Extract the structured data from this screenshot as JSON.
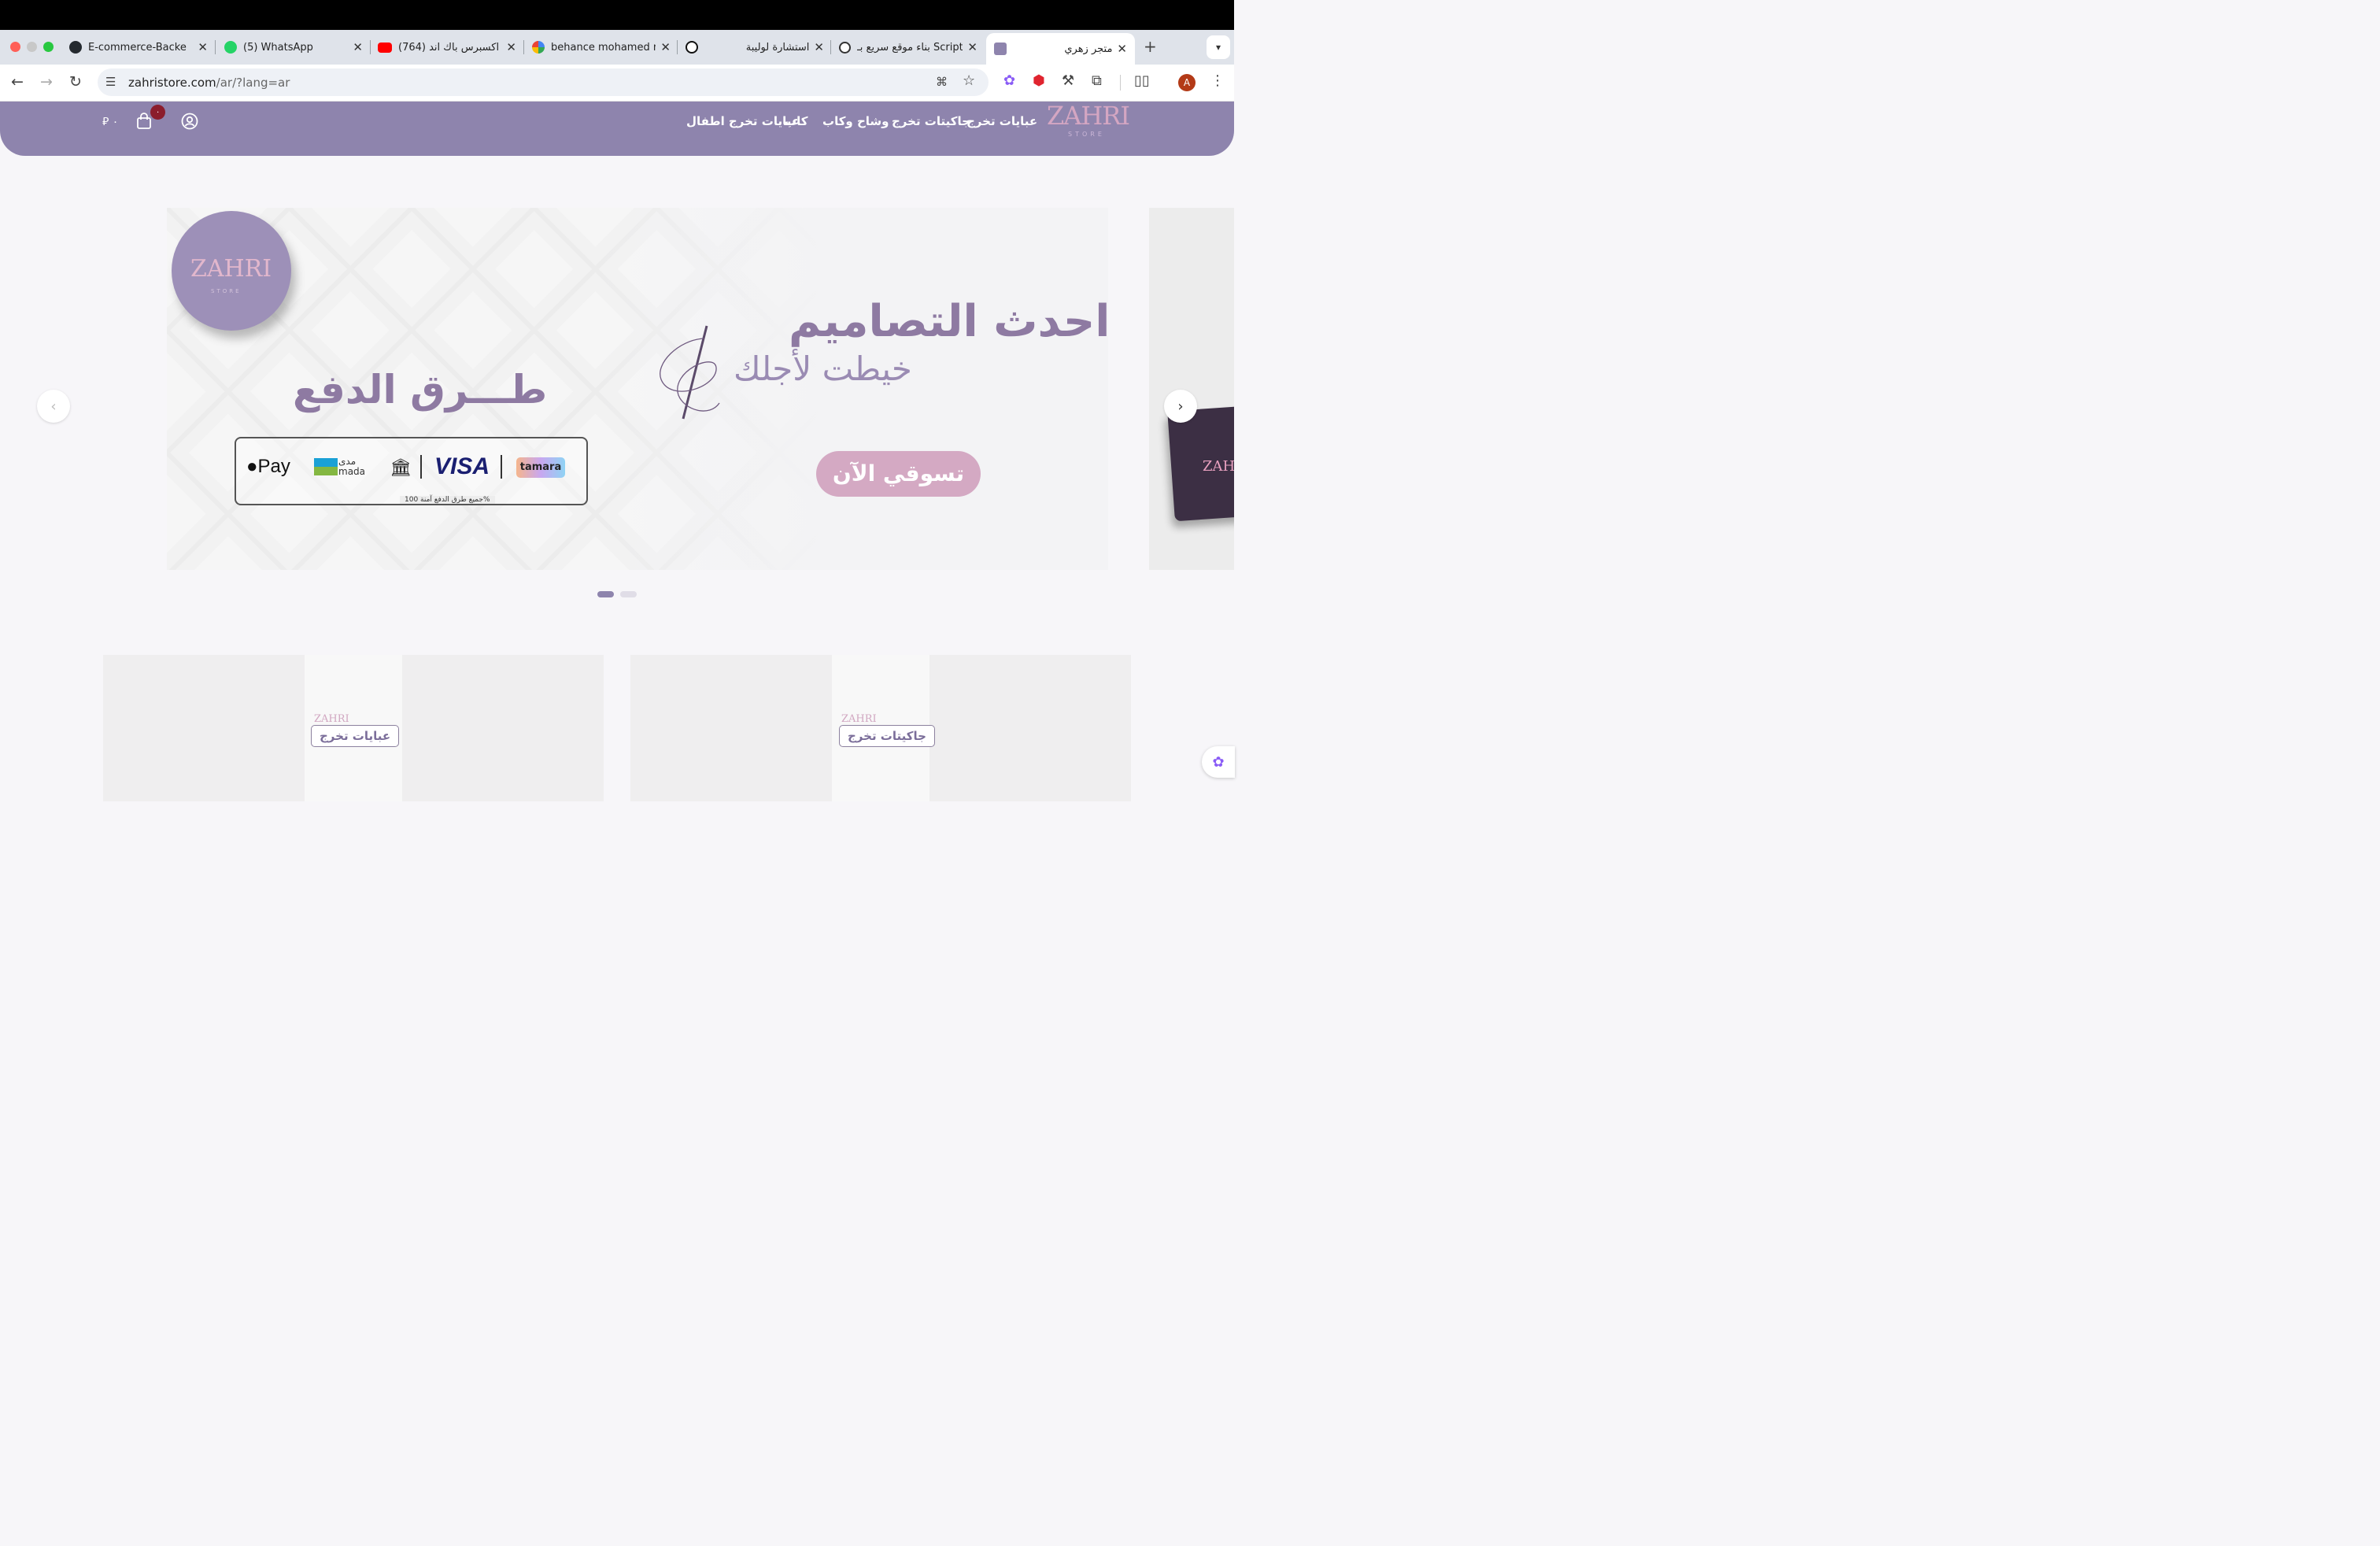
{
  "browser": {
    "tabs": [
      {
        "title": "E-commerce-Backe",
        "icon": "github-icon"
      },
      {
        "title": "(5) WhatsApp",
        "icon": "whatsapp-icon"
      },
      {
        "title": "(764) اكسبرس باك اند",
        "icon": "youtube-icon"
      },
      {
        "title": "behance mohamed n",
        "icon": "google-icon"
      },
      {
        "title": "استشارة لوليبة",
        "icon": "openai-icon"
      },
      {
        "title": "بناء موقع سريع بـ Script",
        "icon": "script-icon"
      },
      {
        "title": "متجر زهري",
        "icon": "zahri-icon",
        "active": true
      }
    ],
    "url_host": "zahristore.com",
    "url_path": "/ar/?lang=ar",
    "profile_initial": "A",
    "new_tab": "+"
  },
  "site": {
    "logo": "ZAHRI",
    "logo_sub": "STORE",
    "menu": [
      "عبايات تخرج",
      "جاكيتات تخرج",
      "وشاح وكاب",
      "كاب",
      "عبايات تخرج اطفال"
    ],
    "cart_count": "٠",
    "currency_amount": "٠"
  },
  "hero": {
    "heading": "احدث التصاميم",
    "subheading": "خيطت لأجلك",
    "cta": "تسوقي الآن",
    "payment_title": "طـــرق الدفع",
    "payment_note": "جميع طرق الدفع آمنة 100%",
    "payment_methods": [
      "Pay",
      "مدى mada",
      "VISA",
      "tamara"
    ],
    "sticker_logo": "ZAHRI",
    "sticker_sub": "STORE",
    "next_slide_logo": "ZAH",
    "prev_arrow": "‹",
    "next_arrow": "›"
  },
  "categories": [
    {
      "logo": "ZAHRI",
      "label": "عبايات تخرج"
    },
    {
      "logo": "ZAHRI",
      "label": "جاكيتات تخرج"
    }
  ],
  "colors": {
    "header": "#8e84ad",
    "accent_purple": "#8e7aa2",
    "cta": "#d4a9c3",
    "active_dot": "#8e84ad",
    "badge": "#8b1d2c"
  }
}
